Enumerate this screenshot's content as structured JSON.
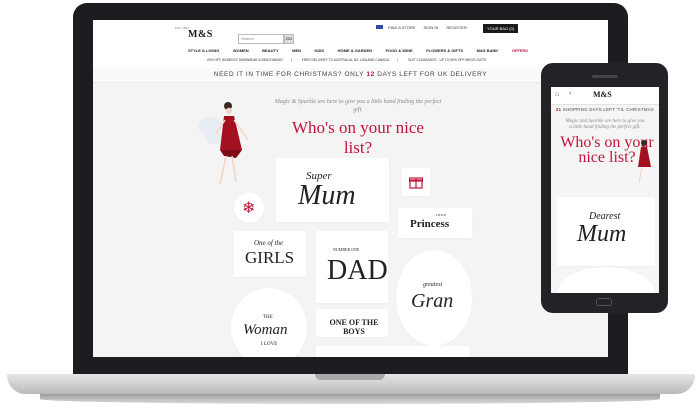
{
  "site": {
    "logo": "M&S",
    "logo_prefix": "EST. 1884",
    "search_placeholder": "Search",
    "search_button": "GO",
    "top_links": [
      "FIND A STORE",
      "SIGN IN",
      "REGISTER"
    ],
    "bag": "YOUR BAG (0)",
    "nav": [
      "STYLE & LIVING",
      "WOMEN",
      "BEAUTY",
      "MEN",
      "KIDS",
      "HOME & GARDEN",
      "FOOD & WINE",
      "FLOWERS & GIFTS",
      "M&S BANK",
      "OFFERS"
    ],
    "promos": [
      "20% OFF WOMEN'S SWIMWEAR & BEACHWEAR",
      "FREE DELIVERY TO AUSTRALIA, NZ, USA AND CANADA",
      "SUIT CLEARANCE - UP TO 50% OFF MEN'S SUITS"
    ],
    "banner_prefix": "NEED IT IN TIME FOR CHRISTMAS? ONLY ",
    "banner_days": "12",
    "banner_suffix": " DAYS LEFT FOR UK DELIVERY",
    "magic_text": "Magic & Sparkle are here to give you a little hand finding the perfect gift.",
    "headline": "Who's on your nice list?"
  },
  "tiles": {
    "super_mum_1": "Super",
    "super_mum_2": "Mum",
    "one_of_the": "One of the",
    "girls": "GIRLS",
    "number_one": "NUMBER ONE",
    "dad": "DAD",
    "little": "LITTLE",
    "princess": "Princess",
    "greatest": "greatest",
    "gran": "Gran",
    "the": "THE",
    "woman": "Woman",
    "i_love": "I LOVE",
    "one_of_the_boys": "ONE OF THE BOYS"
  },
  "phone": {
    "logo": "M&S",
    "banner_days": "21",
    "banner_text": " SHOPPING DAYS LEFT 'TIL CHRISTMAS",
    "magic_text": "Magic and Sparkle are here to give you a little hand finding the perfect gift.",
    "headline": "Who's on your nice list?",
    "tile_dearest": "Dearest",
    "tile_mum": "Mum"
  },
  "colors": {
    "accent": "#c0143c",
    "laptop_bezel": "#1c1d20"
  }
}
